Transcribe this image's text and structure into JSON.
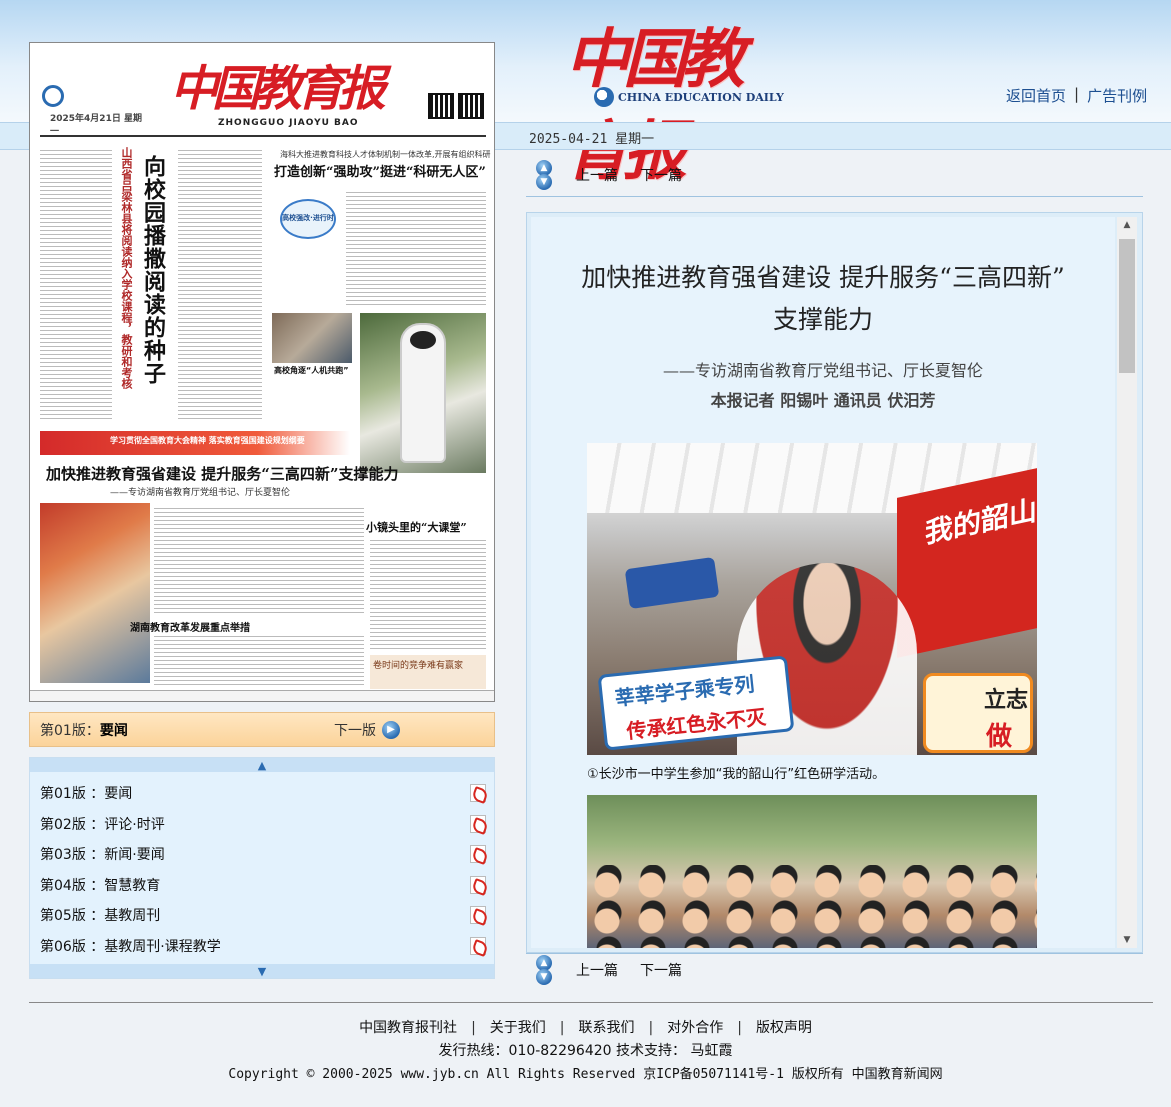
{
  "header": {
    "logo_cn": "中国教育报",
    "logo_en": "CHINA EDUCATION DAILY",
    "links": [
      "返回首页",
      "广告刊例"
    ],
    "date": "2025-04-21 星期一"
  },
  "paper_thumbnail": {
    "masthead": "中国教育报",
    "pinyin": "ZHONGGUO JIAOYU BAO",
    "issue_date": "2025年4月21日 星期一",
    "lead_title": "向校园播撒阅读的种子",
    "lead_subtitle": "山西省吕梁林县将阅读纳入学校课程，教研和考核",
    "top_right_kicker": "海科大推进教育科技人才体制机制一体改革,开展有组织科研",
    "top_right_title": "打造创新“强助攻”挺进“科研无人区”",
    "badge": "高校强改·进行时",
    "photo_caption": "高校角逐“人机共跑”",
    "banner": "学习贯彻全国教育大会精神 落实教育强国建设规划纲要",
    "feature_title": "加快推进教育强省建设 提升服务“三高四新”支撑能力",
    "feature_sub": "——专访湖南省教育厅党组书记、厅长夏智伦",
    "lower_title": "湖南教育改革发展重点举措",
    "mirror_title": "小镜头里的“大课堂”",
    "comment": "卷时间的竞争难有赢家"
  },
  "current_page": {
    "prefix": "第01版：",
    "name": "要闻",
    "next_label": "下一版"
  },
  "page_list": [
    {
      "num": "第01版",
      "name": "：要闻"
    },
    {
      "num": "第02版",
      "name": "：评论·时评"
    },
    {
      "num": "第03版",
      "name": "：新闻·要闻"
    },
    {
      "num": "第04版",
      "name": "：智慧教育"
    },
    {
      "num": "第05版",
      "name": "：基教周刊"
    },
    {
      "num": "第06版",
      "name": "：基教周刊·课程教学"
    }
  ],
  "article_nav": {
    "prev": "上一篇",
    "next": "下一篇"
  },
  "article": {
    "title_line1": "加快推进教育强省建设 提升服务“三高四新”",
    "title_line2": "支撑能力",
    "subtitle": "——专访湖南省教育厅党组书记、厅长夏智伦",
    "byline": "本报记者 阳锡叶 通讯员 伏汨芳",
    "image1_signs": {
      "sign_blue": "莘莘学子乘专列",
      "sign_red": "传承红色永不灭",
      "flag": "我的韶山",
      "sign_orange_top": "立志",
      "sign_orange_bottom": "做"
    },
    "caption1": "①长沙市一中学生参加“我的韶山行”红色研学活动。"
  },
  "footer": {
    "links": [
      "中国教育报刊社",
      "关于我们",
      "联系我们",
      "对外合作",
      "版权声明"
    ],
    "hotline": "发行热线：010-82296420 技术支持： 马虹霞",
    "copyright": "Copyright © 2000-2025 www.jyb.cn All Rights Reserved 京ICP备05071141号-1 版权所有 中国教育新闻网"
  }
}
